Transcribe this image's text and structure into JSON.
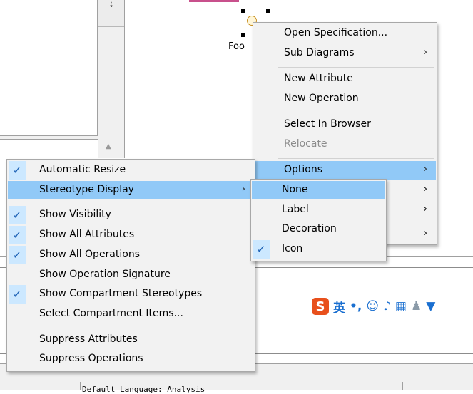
{
  "diagram": {
    "class_label": "Foo"
  },
  "status": {
    "text": "Default Language: Analysis"
  },
  "ime_toolbar": {
    "logo": "S",
    "mode": "英",
    "icons": [
      "punct-icon",
      "smiley-icon",
      "mic-icon",
      "keyboard-icon",
      "user-icon",
      "shirt-icon"
    ]
  },
  "context_menu": {
    "items": [
      {
        "label": "Open Specification...",
        "submenu": false
      },
      {
        "label": "Sub Diagrams",
        "submenu": true
      },
      {
        "label": "New Attribute",
        "submenu": false
      },
      {
        "label": "New Operation",
        "submenu": false
      },
      {
        "label": "Select In Browser",
        "submenu": false
      },
      {
        "label": "Relocate",
        "submenu": false,
        "disabled": true
      },
      {
        "label": "Options",
        "submenu": true,
        "highlighted": true
      }
    ]
  },
  "options_menu": {
    "items": [
      {
        "label": "Automatic Resize",
        "checked": true
      },
      {
        "label": "Stereotype Display",
        "submenu": true,
        "highlighted": true
      },
      {
        "label": "Show Visibility",
        "checked": true
      },
      {
        "label": "Show All Attributes",
        "checked": true
      },
      {
        "label": "Show All Operations",
        "checked": true
      },
      {
        "label": "Show Operation Signature",
        "checked": false
      },
      {
        "label": "Show Compartment Stereotypes",
        "checked": true
      },
      {
        "label": "Select Compartment Items...",
        "checked": false
      },
      {
        "label": "Suppress Attributes",
        "checked": false
      },
      {
        "label": "Suppress Operations",
        "checked": false
      }
    ]
  },
  "stereotype_menu": {
    "items": [
      {
        "label": "None",
        "highlighted": true,
        "checked": false
      },
      {
        "label": "Label",
        "checked": false
      },
      {
        "label": "Decoration",
        "checked": false
      },
      {
        "label": "Icon",
        "checked": true
      }
    ]
  },
  "colors": {
    "highlight": "#91c9f7",
    "check_bg": "#cce8ff",
    "menu_bg": "#f2f2f2",
    "ime_logo": "#e8501c"
  }
}
